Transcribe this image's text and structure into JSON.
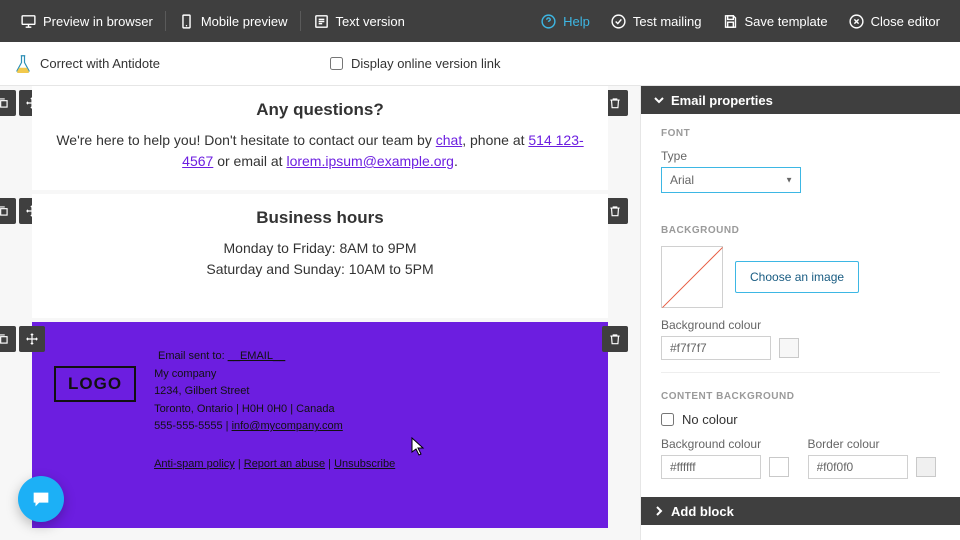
{
  "topbar": {
    "preview": "Preview in browser",
    "mobile": "Mobile preview",
    "text": "Text version",
    "help": "Help",
    "test": "Test mailing",
    "save": "Save template",
    "close": "Close editor"
  },
  "secondbar": {
    "antidote": "Correct with Antidote",
    "online_version": "Display online version link"
  },
  "email": {
    "block1": {
      "title": "Any questions?",
      "line1_pre": "We're here to help you! Don't hesitate to contact our team by ",
      "line1_chat": "chat",
      "line1_post": ", phone at ",
      "phone": "514 123-4567",
      "line1_or": " or email at ",
      "email_link": "lorem.ipsum@example.org",
      "line1_end": "."
    },
    "block2": {
      "title": "Business hours",
      "line1": "Monday to Friday: 8AM to 9PM",
      "line2": "Saturday and Sunday: 10AM to 5PM"
    },
    "footer": {
      "sentto_label": "Email sent to: ",
      "sentto_value": "__EMAIL__",
      "logo": "LOGO",
      "company": "My company",
      "street": "1234, Gilbert Street",
      "city": "Toronto, Ontario | H0H 0H0 | Canada",
      "phone": "555-555-5555",
      "email": "info@mycompany.com",
      "anti_spam": "Anti-spam policy",
      "report": "Report an abuse",
      "unsubscribe": "Unsubscribe"
    }
  },
  "panel": {
    "properties_title": "Email properties",
    "font_heading": "FONT",
    "font_type_label": "Type",
    "font_type_value": "Arial",
    "background_heading": "BACKGROUND",
    "choose_image": "Choose an image",
    "bg_color_label": "Background colour",
    "bg_color_value": "#f7f7f7",
    "content_bg_heading": "CONTENT BACKGROUND",
    "no_colour_label": "No colour",
    "content_bg_label": "Background colour",
    "content_bg_value": "#ffffff",
    "border_label": "Border colour",
    "border_value": "#f0f0f0",
    "add_block_title": "Add block"
  },
  "swatches": {
    "bg": "#f7f7f7",
    "content": "#ffffff",
    "border": "#f0f0f0"
  }
}
